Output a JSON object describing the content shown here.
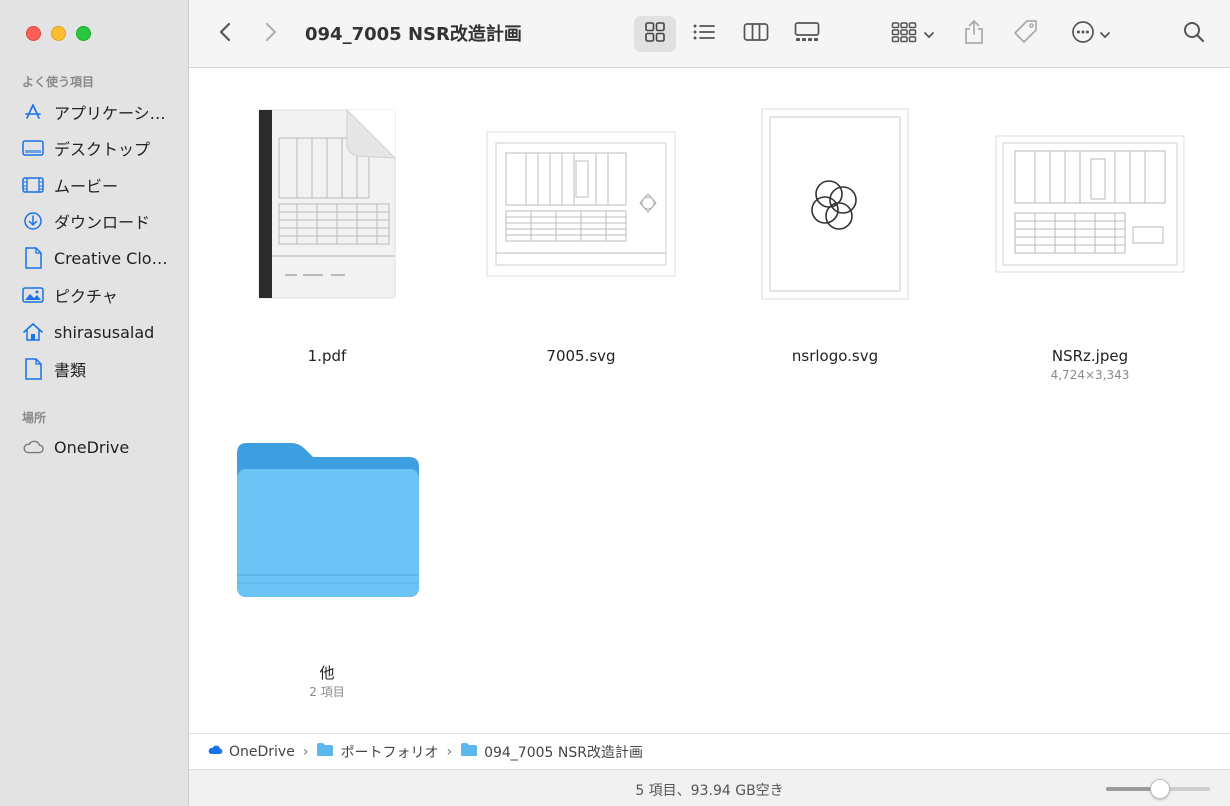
{
  "window": {
    "title": "094_7005 NSR改造計画"
  },
  "sidebar": {
    "favorites_label": "よく使う項目",
    "favorites": [
      {
        "label": "アプリケーシ…",
        "icon": "applications-icon"
      },
      {
        "label": "デスクトップ",
        "icon": "desktop-icon"
      },
      {
        "label": "ムービー",
        "icon": "movies-icon"
      },
      {
        "label": "ダウンロード",
        "icon": "downloads-icon"
      },
      {
        "label": "Creative Clo…",
        "icon": "document-icon"
      },
      {
        "label": "ピクチャ",
        "icon": "pictures-icon"
      },
      {
        "label": "shirasusalad",
        "icon": "home-icon"
      },
      {
        "label": "書類",
        "icon": "documents-icon"
      }
    ],
    "locations_label": "場所",
    "locations": [
      {
        "label": "OneDrive",
        "icon": "cloud-icon"
      }
    ]
  },
  "toolbar": {
    "back": "back-chevron-icon",
    "forward": "forward-chevron-icon",
    "views": [
      "icon-view",
      "list-view",
      "column-view",
      "gallery-view"
    ],
    "active_view": "icon-view"
  },
  "files": [
    {
      "name": "1.pdf",
      "sub": "",
      "kind": "pdf"
    },
    {
      "name": "7005.svg",
      "sub": "",
      "kind": "svg-drawing"
    },
    {
      "name": "nsrlogo.svg",
      "sub": "",
      "kind": "svg-logo"
    },
    {
      "name": "NSRz.jpeg",
      "sub": "4,724×3,343",
      "kind": "jpeg"
    },
    {
      "name": "他",
      "sub": "2 項目",
      "kind": "folder"
    }
  ],
  "pathbar": [
    {
      "label": "OneDrive",
      "icon": "onedrive-cloud-icon"
    },
    {
      "label": "ポートフォリオ",
      "icon": "folder-icon"
    },
    {
      "label": "094_7005 NSR改造計画",
      "icon": "folder-icon"
    }
  ],
  "status": {
    "text": "5 項目、93.94 GB空き",
    "zoom_fraction": 0.52
  },
  "colors": {
    "accent": "#1a73e8",
    "folder": "#6cc4f5",
    "sidebar_bg": "#e3e3e3"
  }
}
